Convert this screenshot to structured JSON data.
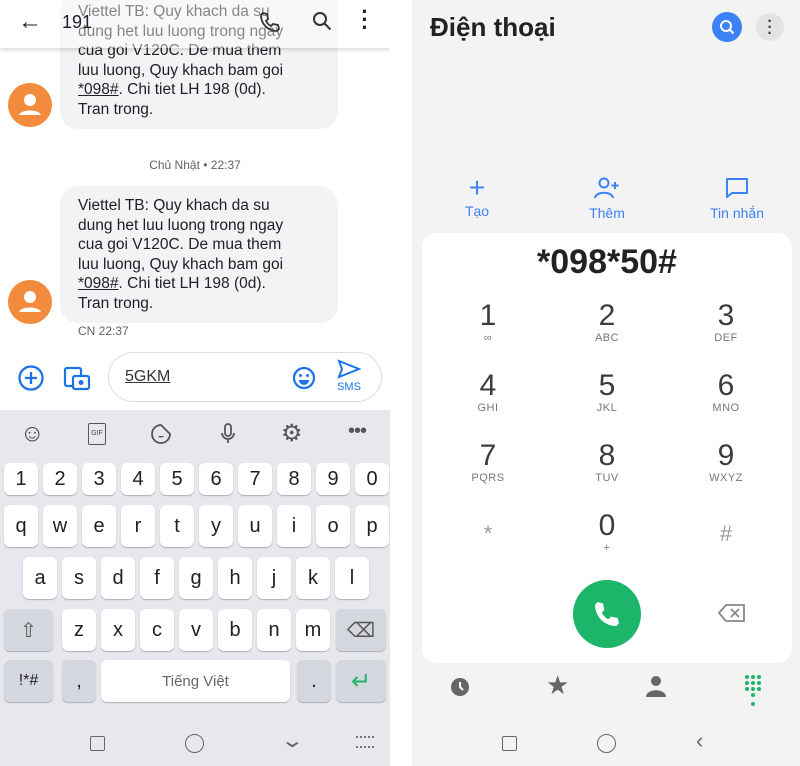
{
  "messages": {
    "header": {
      "title": "191"
    },
    "thread": [
      {
        "lines": [
          "Viettel TB: Quy khach da su",
          "dung het luu luong trong ngay",
          "cua goi V120C. De mua them",
          "luu luong, Quy khach bam goi"
        ],
        "code": "*098#",
        "rest": ". Chi tiet LH 198 (0d).",
        "last": "Tran trong."
      },
      {
        "lines": [
          "Viettel TB: Quy khach da su",
          "dung het luu luong trong ngay",
          "cua goi V120C. De mua them",
          "luu luong, Quy khach bam goi"
        ],
        "code": "*098#",
        "rest": ". Chi tiet LH 198 (0d).",
        "last": "Tran trong.",
        "time": "CN 22:37"
      }
    ],
    "date_divider": "Chủ Nhật • 22:37",
    "compose": {
      "value": "5GKM",
      "send_label": "SMS"
    }
  },
  "keyboard": {
    "rows": [
      [
        "1",
        "2",
        "3",
        "4",
        "5",
        "6",
        "7",
        "8",
        "9",
        "0"
      ],
      [
        "q",
        "w",
        "e",
        "r",
        "t",
        "y",
        "u",
        "i",
        "o",
        "p"
      ],
      [
        "a",
        "s",
        "d",
        "f",
        "g",
        "h",
        "j",
        "k",
        "l"
      ],
      [
        "z",
        "x",
        "c",
        "v",
        "b",
        "n",
        "m"
      ]
    ],
    "symbols": "!*#",
    "comma": ",",
    "space": "Tiếng Việt",
    "period": "."
  },
  "dialer": {
    "title": "Điện thoại",
    "actions": [
      {
        "label": "Tạo",
        "icon": "plus-icon"
      },
      {
        "label": "Thêm",
        "icon": "add-contact-icon"
      },
      {
        "label": "Tin nhắn",
        "icon": "message-icon"
      }
    ],
    "number": "*098*50#",
    "keys": [
      [
        "1",
        "∞"
      ],
      [
        "2",
        "ABC"
      ],
      [
        "3",
        "DEF"
      ],
      [
        "4",
        "GHI"
      ],
      [
        "5",
        "JKL"
      ],
      [
        "6",
        "MNO"
      ],
      [
        "7",
        "PQRS"
      ],
      [
        "8",
        "TUV"
      ],
      [
        "9",
        "WXYZ"
      ],
      [
        "*",
        ""
      ],
      [
        "0",
        "+"
      ],
      [
        "#",
        ""
      ]
    ],
    "colors": {
      "call": "#1db56a",
      "accent": "#3b82f6"
    }
  }
}
